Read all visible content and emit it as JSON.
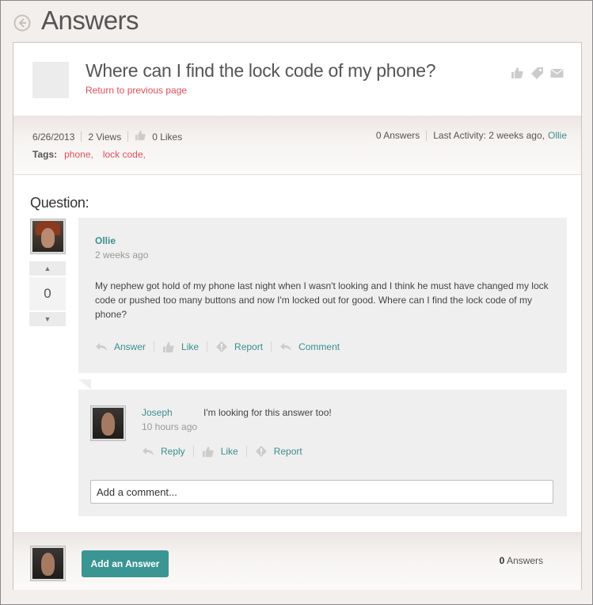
{
  "header": {
    "title": "Answers"
  },
  "question": {
    "title": "Where can I find the lock code of my phone?",
    "return_link": "Return to previous page",
    "date": "6/26/2013",
    "views": "2 Views",
    "likes": "0 Likes",
    "answers": "0 Answers",
    "last_activity_label": "Last Activity: 2 weeks ago,",
    "last_activity_user": "Ollie",
    "tags_label": "Tags:",
    "tags": [
      "phone,",
      "lock code,"
    ],
    "section_label": "Question:",
    "vote_count": "0",
    "vote_up": "▲",
    "vote_down": "▼",
    "author": "Ollie",
    "time": "2 weeks ago",
    "body": "My nephew got hold of my phone last night when I wasn't looking and I think he must have changed my lock code or pushed too many buttons and now I'm locked out for good. Where can I find the lock code of my phone?",
    "actions": {
      "answer": "Answer",
      "like": "Like",
      "report": "Report",
      "comment": "Comment"
    }
  },
  "comment": {
    "author": "Joseph",
    "text": "I'm looking for this answer too!",
    "time": "10 hours ago",
    "actions": {
      "reply": "Reply",
      "like": "Like",
      "report": "Report"
    }
  },
  "add_comment": {
    "placeholder": "Add a comment..."
  },
  "footer": {
    "add_answer_label": "Add an Answer",
    "answers_count": "0",
    "answers_label": "Answers"
  },
  "colors": {
    "accent": "#3b8e8e",
    "link": "#e04e5c",
    "button": "#3b9592"
  },
  "icons": [
    "back-arrow-icon",
    "thumbs-up-icon",
    "tag-icon",
    "envelope-icon",
    "reply-arrow-icon",
    "flag-icon"
  ]
}
